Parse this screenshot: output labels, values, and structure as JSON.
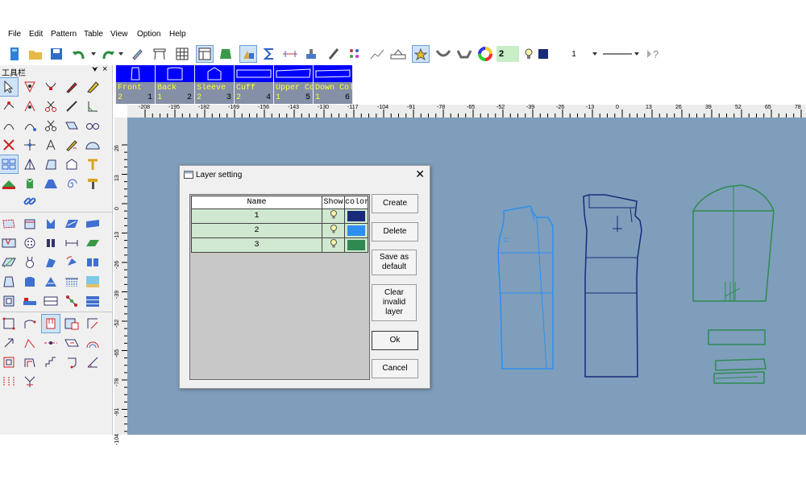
{
  "menu": {
    "items": [
      "File",
      "Edit",
      "Pattern",
      "Table",
      "View",
      "Option",
      "Help"
    ]
  },
  "toolbar": {
    "layer_value": "2",
    "line_width_value": "1",
    "icons": [
      "new-file-icon",
      "open-folder-icon",
      "save-icon",
      "undo-icon",
      "redo-icon",
      "pen-icon",
      "table-frame-icon",
      "grid-icon",
      "window-icon",
      "green-shape-icon",
      "pieces-icon",
      "sigma-icon",
      "measure-icon",
      "stamp-icon",
      "brush-icon",
      "dots-icon",
      "graph-icon",
      "ruler-icon",
      "highlight-icon",
      "curve-icon",
      "curve2-icon",
      "color-wheel-icon",
      "bulb-icon",
      "color-square-icon",
      "help-icon"
    ]
  },
  "leftpanel": {
    "title": "工具栏",
    "pin": "⮟",
    "close": "×"
  },
  "pieces": [
    {
      "name": "Front",
      "qty": "2",
      "no": "1"
    },
    {
      "name": "Back",
      "qty": "1",
      "no": "2"
    },
    {
      "name": "Sleeve",
      "qty": "2",
      "no": "3"
    },
    {
      "name": "Cuff",
      "qty": "2",
      "no": "4"
    },
    {
      "name": "Upper Collar",
      "qty": "1",
      "no": "5"
    },
    {
      "name": "Down Collar",
      "qty": "1",
      "no": "6"
    }
  ],
  "ruler": {
    "h_labels": [
      "-208",
      "-195",
      "-182",
      "-169",
      "-156",
      "-143",
      "-130",
      "-117",
      "-104",
      "-91",
      "-78",
      "-65",
      "-52",
      "-39",
      "-26",
      "-13",
      "0",
      "13",
      "26",
      "39",
      "52",
      "65",
      "78",
      "91"
    ],
    "v_labels": [
      "26",
      "13",
      "0",
      "-13",
      "-26",
      "-39",
      "-52",
      "-65",
      "-78",
      "-91",
      "-104"
    ]
  },
  "dialog": {
    "title": "Layer setting",
    "columns": [
      "Name",
      "Show",
      "color"
    ],
    "layers": [
      {
        "name": "1",
        "color": "#1a2a7a"
      },
      {
        "name": "2",
        "color": "#2d8ff0"
      },
      {
        "name": "3",
        "color": "#2f8a52"
      }
    ],
    "buttons": {
      "create": "Create",
      "delete": "Delete",
      "save_default": "Save as default",
      "clear_invalid": "Clear invalid layer",
      "ok": "Ok",
      "cancel": "Cancel"
    }
  },
  "colors": {
    "canvas": "#7e9ebb",
    "piece_tab_active": "#0000ff",
    "piece_label_text": "#ffff40",
    "front_outline": "#2d8ff0",
    "back_outline": "#1a2a7a",
    "sleeve_outline": "#2f8a52"
  }
}
